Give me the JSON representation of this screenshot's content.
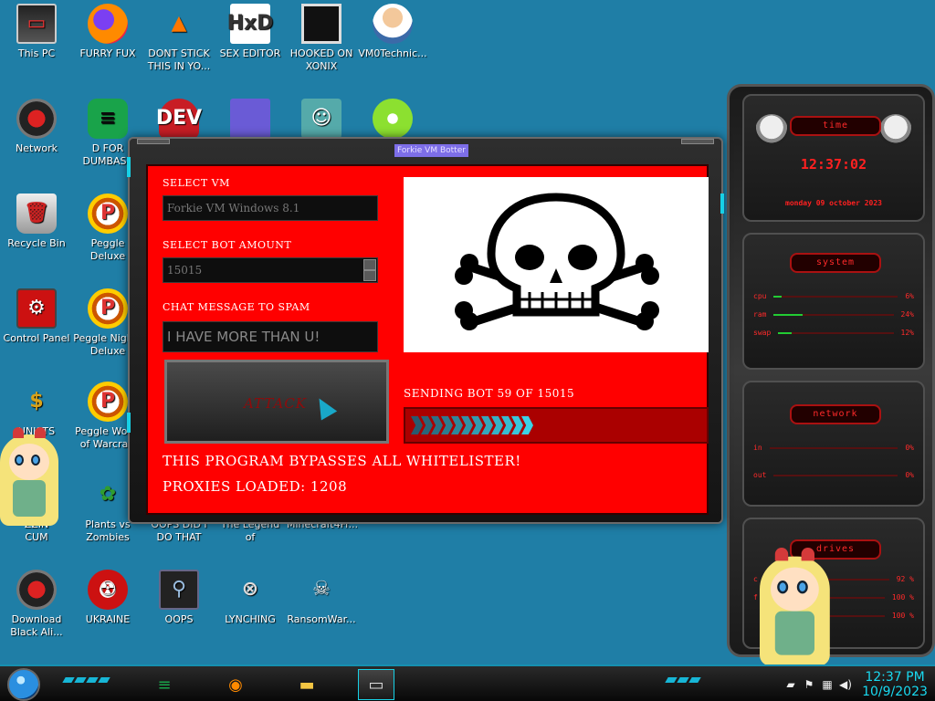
{
  "desktop_icons": [
    {
      "label": "This PC",
      "glyph": "▭",
      "icon": "monitor-icon"
    },
    {
      "label": "FURRY FUX",
      "glyph": "",
      "icon": "firefox-icon"
    },
    {
      "label": "DONT STICK\nTHIS IN YO...",
      "glyph": "▲",
      "icon": "traffic-cone-icon"
    },
    {
      "label": "SEX EDITOR",
      "glyph": "HxD",
      "icon": "hex-editor-icon"
    },
    {
      "label": "HOOKED ON\nXONIX",
      "glyph": "",
      "icon": "xonix-icon"
    },
    {
      "label": "VM0Technic...",
      "glyph": "",
      "icon": "doctor-icon"
    },
    {
      "label": "Network",
      "glyph": "",
      "icon": "network-icon"
    },
    {
      "label": "D FOR\nDUMBASS",
      "glyph": "≡",
      "icon": "green-app-icon"
    },
    {
      "label": "",
      "glyph": "DEV",
      "icon": "devcpp-icon"
    },
    {
      "label": "",
      "glyph": "",
      "icon": "window-app-icon"
    },
    {
      "label": "",
      "glyph": "☺",
      "icon": "gnome-icon"
    },
    {
      "label": "",
      "glyph": "",
      "icon": "lime-icon"
    },
    {
      "label": "Recycle Bin",
      "glyph": "🗑",
      "icon": "recycle-bin-icon"
    },
    {
      "label": "Peggle Deluxe",
      "glyph": "P",
      "icon": "peggle-icon"
    },
    {
      "label": "Control Panel",
      "glyph": "⚙",
      "icon": "control-panel-icon"
    },
    {
      "label": "Peggle Nights\nDeluxe",
      "glyph": "P",
      "icon": "peggle-nights-icon"
    },
    {
      "label": "UNISTS\nS G...",
      "glyph": "$",
      "icon": "money-bag-icon"
    },
    {
      "label": "Peggle World\nof Warcraft",
      "glyph": "P",
      "icon": "peggle-wow-icon"
    },
    {
      "label": "ZZIN\nCUM",
      "glyph": "",
      "icon": "folder-icon"
    },
    {
      "label": "Plants vs\nZombies",
      "glyph": "✿",
      "icon": "plants-vs-zombies-icon"
    },
    {
      "label": "OOPS DID I\nDO THAT",
      "glyph": "",
      "icon": "file-icon"
    },
    {
      "label": "The Legend of\nZilda",
      "glyph": "",
      "icon": "zilda-icon"
    },
    {
      "label": "Minecraft4Fr...",
      "glyph": "",
      "icon": "minecraft-icon"
    },
    {
      "label": "Download\nBlack Ali...",
      "glyph": "",
      "icon": "alien-download-icon"
    },
    {
      "label": "UKRAINE",
      "glyph": "☢",
      "icon": "radiation-icon"
    },
    {
      "label": "OOPS",
      "glyph": "⚲",
      "icon": "book-icon"
    },
    {
      "label": "LYNCHING",
      "glyph": "⊗",
      "icon": "noose-icon"
    },
    {
      "label": "RansomWar...",
      "glyph": "☠",
      "icon": "skull-icon"
    }
  ],
  "app": {
    "title": "Forkie VM Botter",
    "select_vm_label": "SELECT VM",
    "select_vm_value": "Forkie VM Windows 8.1",
    "bot_amount_label": "SELECT BOT AMOUNT",
    "bot_amount_value": "15015",
    "chat_label": "CHAT MESSAGE TO SPAM",
    "chat_value": "I HAVE MORE THAN U!",
    "attack_label": "ATTACK",
    "progress_label": "SENDING BOT 59 OF 15015",
    "progress_fraction": 0.5,
    "info_1": "THIS PROGRAM BYPASSES ALL WHITELISTER!",
    "info_2": "PROXIES LOADED: 1208"
  },
  "gadgets": {
    "clock": {
      "title": "time",
      "time": "12:37:02",
      "date": "monday 09 october 2023"
    },
    "system": {
      "title": "system",
      "rows": [
        {
          "label": "cpu",
          "value": "6%",
          "level": 0.06
        },
        {
          "label": "ram",
          "value": "24%",
          "level": 0.24
        },
        {
          "label": "swap",
          "value": "12%",
          "level": 0.12
        }
      ]
    },
    "network": {
      "title": "network",
      "rows": [
        {
          "label": "in",
          "value": "0%"
        },
        {
          "label": "out",
          "value": "0%"
        }
      ]
    },
    "drives": {
      "title": "drives",
      "rows": [
        {
          "label": "c",
          "value": "92 %"
        },
        {
          "label": "f",
          "value": "100 %"
        },
        {
          "label": "",
          "value": "100 %"
        }
      ]
    }
  },
  "taskbar": {
    "apps": [
      {
        "icon": "green-app-icon",
        "glyph": "≡"
      },
      {
        "icon": "firefox-icon",
        "glyph": "◉"
      },
      {
        "icon": "file-explorer-icon",
        "glyph": "▬"
      },
      {
        "icon": "vm-window-icon",
        "glyph": "▭",
        "active": true
      }
    ],
    "time": "12:37 PM",
    "date": "10/9/2023"
  },
  "colors": {
    "desktop_bg": "#1f7ea6",
    "app_body": "#ff0000",
    "accent_cyan": "#17d1e6",
    "gadget_red": "#ff2a2a"
  }
}
